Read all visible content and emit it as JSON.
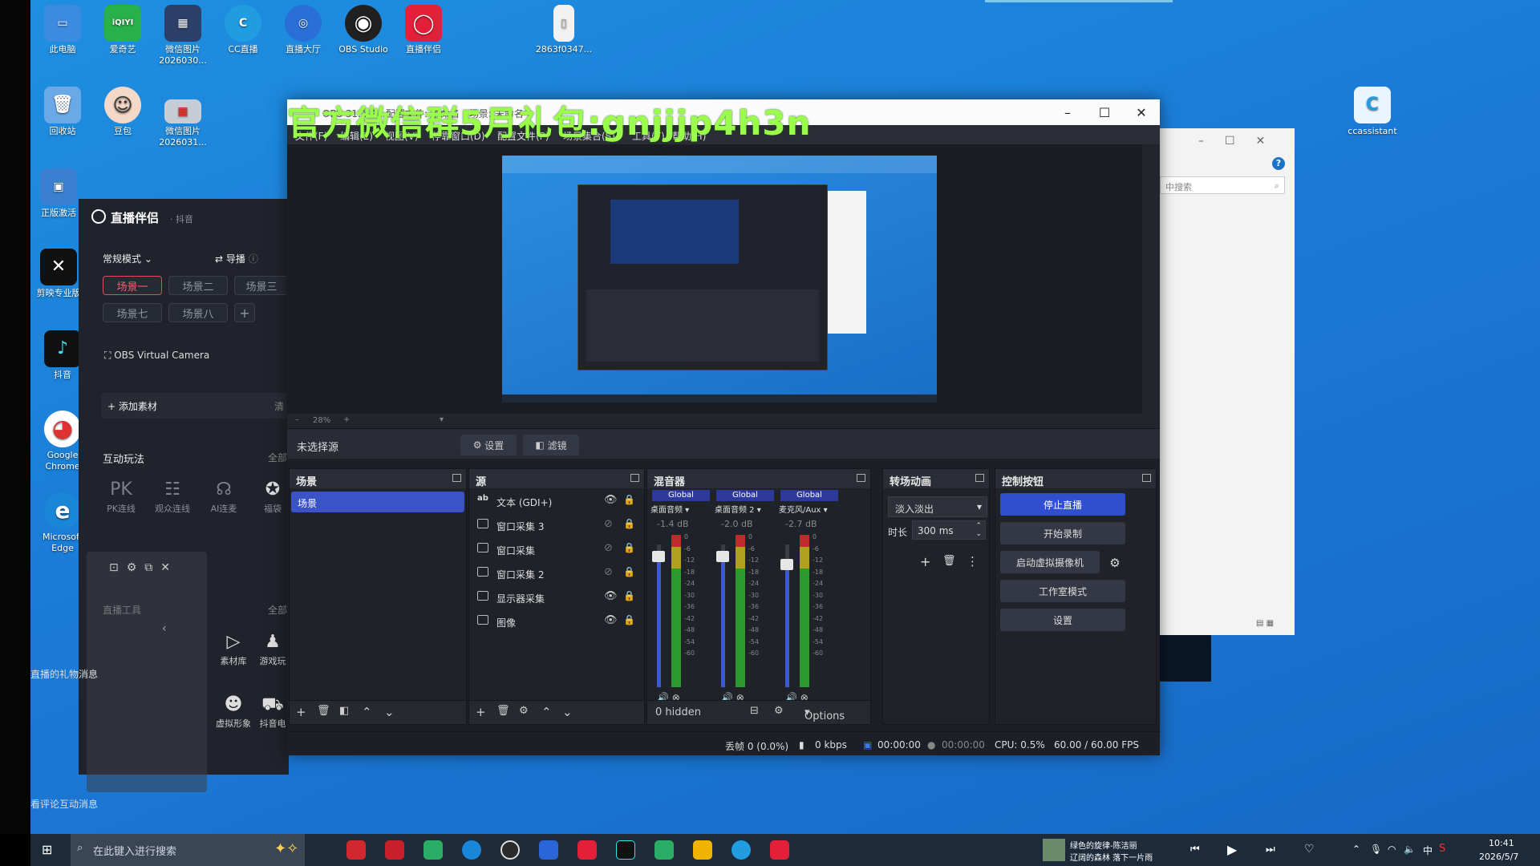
{
  "desktop": {
    "icons": [
      {
        "label": "此电脑",
        "color": "#3d8be0",
        "glyph": "▭"
      },
      {
        "label": "爱奇艺",
        "color": "#28b04a",
        "glyph": "iQIYI"
      },
      {
        "label": "微信图片\n2026030...",
        "color": "#2b3f6a",
        "glyph": "▦"
      },
      {
        "label": "CC直播",
        "color": "#1f9de0",
        "glyph": "C"
      },
      {
        "label": "直播大厅",
        "color": "#2a6fd8",
        "glyph": "◎"
      },
      {
        "label": "OBS Studio",
        "color": "#202020",
        "glyph": "◉"
      },
      {
        "label": "直播伴侣",
        "color": "#e2203a",
        "glyph": "◯"
      },
      {
        "label": "2863f0347...",
        "color": "#f2f2f2",
        "glyph": "▯"
      },
      {
        "label": "回收站",
        "color": "#6aa9e8",
        "glyph": "🗑"
      },
      {
        "label": "豆包",
        "color": "#f4d8c8",
        "glyph": "☺"
      },
      {
        "label": "微信图片\n2026031...",
        "color": "#c8ccd4",
        "glyph": "▦"
      },
      {
        "label": "正版激活",
        "color": "#3a7fd0",
        "glyph": "▣"
      },
      {
        "label": "剪映专业版",
        "color": "#111111",
        "glyph": "✕"
      },
      {
        "label": "抖音",
        "color": "#111111",
        "glyph": "♪"
      },
      {
        "label": "Google\nChrome",
        "color": "#ffffff",
        "glyph": "◕"
      },
      {
        "label": "Microsoft\nEdge",
        "color": "#1a86d8",
        "glyph": "e"
      },
      {
        "label": "ccassistant",
        "color": "#eaf6ff",
        "glyph": "C"
      }
    ]
  },
  "watermark": "官方微信群5月礼包:gnjjjp4h3n",
  "companion": {
    "title": "直播伴侣",
    "subtitle": "· 抖音",
    "mode": "常规模式",
    "guide": "导播",
    "scenes": [
      "场景一",
      "场景二",
      "场景三",
      "场景七",
      "场景八"
    ],
    "add_scene": "+",
    "source": "OBS Virtual Camera",
    "add_material": "添加素材",
    "clear": "清",
    "interactive_title": "互动玩法",
    "all": "全部",
    "tools": [
      {
        "label": "PK连线",
        "glyph": "PK"
      },
      {
        "label": "观众连线",
        "glyph": "☷"
      },
      {
        "label": "AI连麦",
        "glyph": "☊"
      },
      {
        "label": "福袋",
        "glyph": "✪"
      }
    ],
    "more_tools_title": "直播工具",
    "more_all": "全部",
    "tools2": [
      {
        "label": "素材库",
        "glyph": "▷"
      },
      {
        "label": "游戏玩",
        "glyph": "♟"
      },
      {
        "label": "虚拟形象",
        "glyph": "☻"
      },
      {
        "label": "抖音电",
        "glyph": "⛟"
      }
    ],
    "gift_msg": "直播的礼物消息",
    "comment_msg": "看评论互动消息"
  },
  "obs": {
    "title": "OBS 31.1.0 - 配置文件: 未命名 - 场景: 未命名",
    "menu": [
      "文件(F)",
      "编辑(E)",
      "视图(V)",
      "停靠窗口(D)",
      "配置文件(P)",
      "场景集合(S)",
      "工具(T)",
      "帮助(H)"
    ],
    "zoom": "28%",
    "no_source": "未选择源",
    "settings_btn": "设置",
    "filter_btn": "滤镜",
    "scenes_title": "场景",
    "scenes": [
      "场景"
    ],
    "sources_title": "源",
    "sources": [
      {
        "name": "文本 (GDI+)",
        "icon": "ab",
        "visible": true
      },
      {
        "name": "窗口采集 3",
        "icon": "▭",
        "visible": false
      },
      {
        "name": "窗口采集",
        "icon": "▭",
        "visible": false
      },
      {
        "name": "窗口采集 2",
        "icon": "▭",
        "visible": false
      },
      {
        "name": "显示器采集",
        "icon": "▭",
        "visible": true
      },
      {
        "name": "图像",
        "icon": "▣",
        "visible": true
      }
    ],
    "mixer_title": "混音器",
    "mixer": [
      {
        "tag": "Global",
        "name": "桌面音频",
        "db": "-1.4 dB",
        "level": 0.78
      },
      {
        "tag": "Global",
        "name": "桌面音频 2",
        "db": "-2.0 dB",
        "level": 0.78
      },
      {
        "tag": "Global",
        "name": "麦克风/Aux",
        "db": "-2.7 dB",
        "level": 0.72
      }
    ],
    "mixer_scale": [
      "0",
      "-6",
      "-12",
      "-18",
      "-24",
      "-30",
      "-36",
      "-42",
      "-48",
      "-54",
      "-60"
    ],
    "hidden": "0 hidden",
    "options": "Options",
    "transitions_title": "转场动画",
    "transition": "淡入淡出",
    "duration_label": "时长",
    "duration": "300 ms",
    "controls_title": "控制按钮",
    "controls": [
      "停止直播",
      "开始录制",
      "启动虚拟摄像机",
      "工作室模式",
      "设置"
    ],
    "status": {
      "dropped": "丢帧 0 (0.0%)",
      "bitrate": "0 kbps",
      "live_time": "00:00:00",
      "rec_time": "00:00:00",
      "cpu": "CPU: 0.5%",
      "fps": "60.00 / 60.00 FPS"
    }
  },
  "explorer": {
    "search": "中搜索"
  },
  "taskbar": {
    "search_placeholder": "在此键入进行搜索",
    "apps": [
      {
        "name": "wps",
        "color": "#d0282e"
      },
      {
        "name": "netease",
        "color": "#c8202a"
      },
      {
        "name": "wechat",
        "color": "#2aae67"
      },
      {
        "name": "edge",
        "color": "#1a86d8"
      },
      {
        "name": "obs",
        "color": "#2b2b2b"
      },
      {
        "name": "kugou",
        "color": "#2a66d9"
      },
      {
        "name": "companion",
        "color": "#e2203a"
      },
      {
        "name": "douyin",
        "color": "#111111"
      },
      {
        "name": "wechat2",
        "color": "#2aae67"
      },
      {
        "name": "files",
        "color": "#f0b400"
      },
      {
        "name": "cc",
        "color": "#1f9de0"
      },
      {
        "name": "companion2",
        "color": "#e2203a"
      }
    ],
    "music_title": "绿色的旋律-陈洁丽",
    "music_sub": "辽阔的森林 落下一片雨",
    "ime": "中",
    "time": "10:41",
    "date": "2026/5/7"
  }
}
